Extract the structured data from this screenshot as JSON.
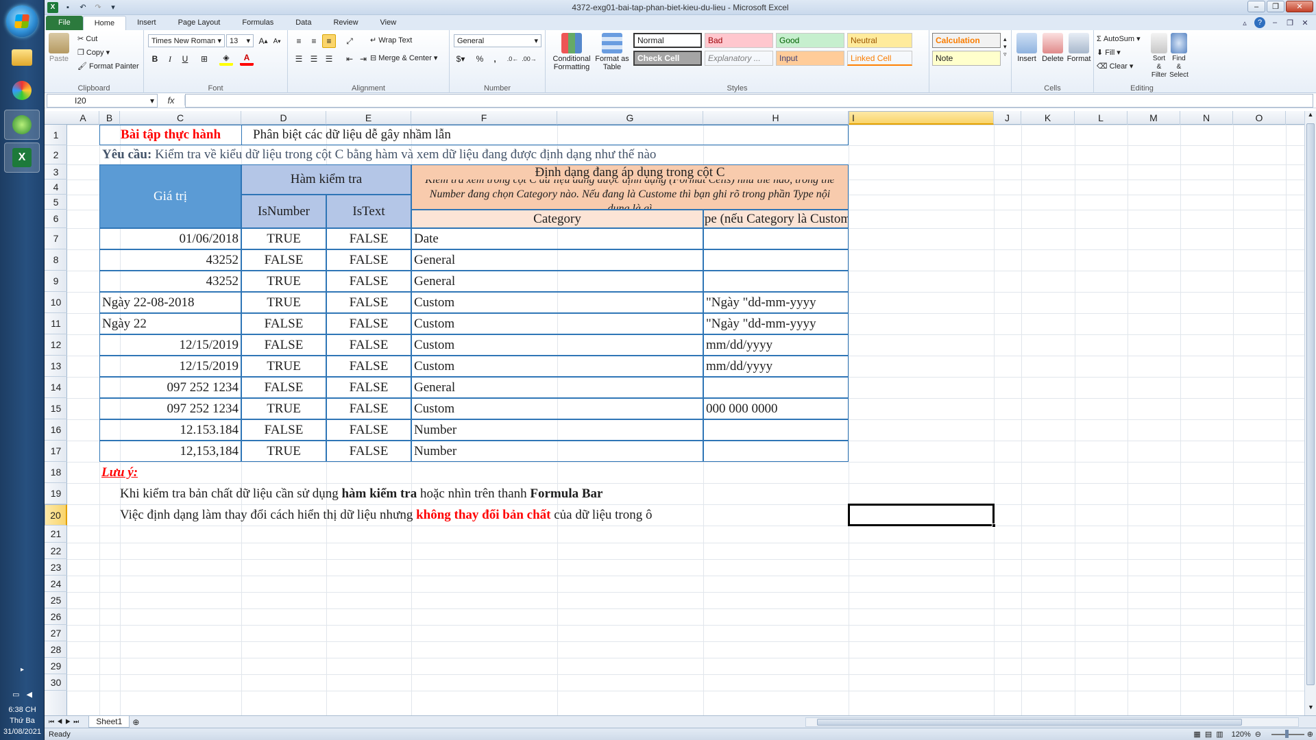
{
  "window": {
    "title": "4372-exg01-bai-tap-phan-biet-kieu-du-lieu - Microsoft Excel"
  },
  "ribbon_tabs": [
    "File",
    "Home",
    "Insert",
    "Page Layout",
    "Formulas",
    "Data",
    "Review",
    "View"
  ],
  "clipboard": {
    "paste": "Paste",
    "cut": "Cut",
    "copy": "Copy",
    "format_painter": "Format Painter",
    "label": "Clipboard"
  },
  "font": {
    "name": "Times New Roman",
    "size": "13",
    "label": "Font",
    "bold": "B",
    "italic": "I",
    "underline": "U"
  },
  "alignment": {
    "wrap": "Wrap Text",
    "merge": "Merge & Center",
    "label": "Alignment"
  },
  "number": {
    "format": "General",
    "label": "Number",
    "percent": "%",
    "comma": ","
  },
  "styles": {
    "conditional": "Conditional Formatting",
    "as_table": "Format as Table",
    "items": [
      "Normal",
      "Bad",
      "Good",
      "Neutral",
      "Calculation",
      "Check Cell",
      "Explanatory ...",
      "Input",
      "Linked Cell",
      "Note"
    ],
    "label": "Styles"
  },
  "cells_group": {
    "insert": "Insert",
    "delete": "Delete",
    "format": "Format",
    "label": "Cells"
  },
  "editing": {
    "autosum": "AutoSum",
    "fill": "Fill",
    "clear": "Clear",
    "sort": "Sort & Filter",
    "find": "Find & Select",
    "label": "Editing"
  },
  "namebox": "I20",
  "fx": "fx",
  "columns": [
    "A",
    "B",
    "C",
    "D",
    "E",
    "F",
    "G",
    "H",
    "I",
    "J",
    "K",
    "L",
    "M",
    "N",
    "O"
  ],
  "rows": [
    "1",
    "2",
    "3",
    "4",
    "5",
    "6",
    "7",
    "8",
    "9",
    "10",
    "11",
    "12",
    "13",
    "14",
    "15",
    "16",
    "17",
    "18",
    "19",
    "20",
    "21",
    "22",
    "23",
    "24",
    "25",
    "26",
    "27",
    "28",
    "29",
    "30"
  ],
  "sheet": {
    "title_left": "Bài tập thực hành",
    "title_right": "Phân biệt các dữ liệu dễ gây nhầm lẫn",
    "req_label": "Yêu cầu:",
    "req_text": " Kiểm tra về kiểu dữ liệu trong cột C bằng hàm và xem dữ liệu đang được định dạng như thế nào",
    "h_value": "Giá trị",
    "h_func": "Hàm kiểm tra",
    "h_isnumber": "IsNumber",
    "h_istext": "IsText",
    "h_format": "Định dạng đang áp dụng trong cột C",
    "h_format_desc": "Kiểm tra xem trong cột C dữ liệu đang được định dạng (Format Cells) như thế nào, trong thẻ Number đang chọn Category nào. Nếu đang là Custome thì bạn ghi rõ trong phần Type nội dung là gì",
    "h_category": "Category",
    "h_type": "Type (nếu Category là Custome)",
    "rows": [
      {
        "value": "01/06/2018",
        "align": "right",
        "isnumber": "TRUE",
        "istext": "FALSE",
        "category": "Date",
        "type": ""
      },
      {
        "value": "43252",
        "align": "right",
        "isnumber": "FALSE",
        "istext": "FALSE",
        "category": "General",
        "type": ""
      },
      {
        "value": "43252",
        "align": "right",
        "isnumber": "TRUE",
        "istext": "FALSE",
        "category": "General",
        "type": ""
      },
      {
        "value": "Ngày 22-08-2018",
        "align": "left",
        "isnumber": "TRUE",
        "istext": "FALSE",
        "category": "Custom",
        "type": "\"Ngày \"dd-mm-yyyy"
      },
      {
        "value": "Ngày 22",
        "align": "left",
        "isnumber": "FALSE",
        "istext": "FALSE",
        "category": "Custom",
        "type": "\"Ngày \"dd-mm-yyyy"
      },
      {
        "value": "12/15/2019",
        "align": "right",
        "isnumber": "FALSE",
        "istext": "FALSE",
        "category": "Custom",
        "type": "mm/dd/yyyy"
      },
      {
        "value": "12/15/2019",
        "align": "right",
        "isnumber": "TRUE",
        "istext": "FALSE",
        "category": "Custom",
        "type": "mm/dd/yyyy"
      },
      {
        "value": "097 252 1234",
        "align": "right",
        "isnumber": "FALSE",
        "istext": "FALSE",
        "category": "General",
        "type": ""
      },
      {
        "value": "097 252 1234",
        "align": "right",
        "isnumber": "TRUE",
        "istext": "FALSE",
        "category": "Custom",
        "type": "000 000 0000"
      },
      {
        "value": "12.153.184",
        "align": "right",
        "isnumber": "FALSE",
        "istext": "FALSE",
        "category": "Number",
        "type": ""
      },
      {
        "value": "12,153,184",
        "align": "right",
        "isnumber": "TRUE",
        "istext": "FALSE",
        "category": "Number",
        "type": ""
      }
    ],
    "note_label": "Lưu ý:",
    "note1_a": "Khi kiểm tra bản chất dữ liệu cần sử dụng ",
    "note1_b": "hàm kiểm tra",
    "note1_c": " hoặc nhìn trên thanh ",
    "note1_d": "Formula Bar",
    "note2_a": "Việc định dạng làm thay đổi cách hiển thị dữ liệu nhưng ",
    "note2_b": "không thay đổi bản chất",
    "note2_c": " của dữ liệu trong ô"
  },
  "sheet_tab": "Sheet1",
  "status": {
    "ready": "Ready",
    "zoom": "120%"
  },
  "taskbar": {
    "time": "6:38 CH",
    "day": "Thứ Ba",
    "date": "31/08/2021"
  },
  "colors": {
    "accent_blue": "#5b9bd5",
    "light_blue": "#b4c6e7",
    "peach": "#f8cbad",
    "light_peach": "#fce4d6",
    "red": "#ff0000",
    "border": "#2e75b6"
  }
}
